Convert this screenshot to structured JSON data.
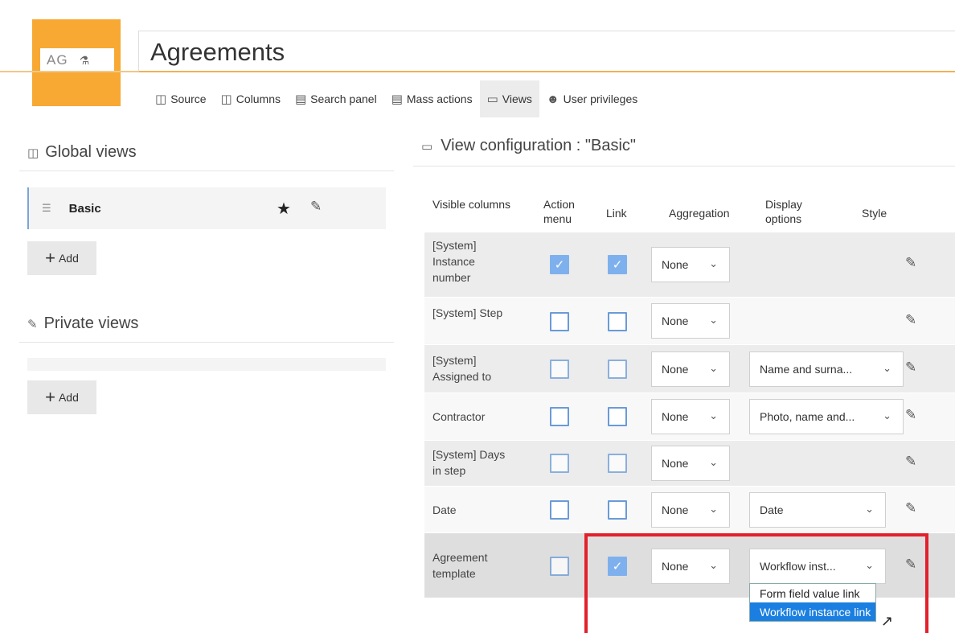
{
  "app": {
    "logo_text": "AG",
    "logo_icon": "user-tree-icon",
    "title": "Agreements"
  },
  "tabs": [
    {
      "label": "Source",
      "icon": "database-icon"
    },
    {
      "label": "Columns",
      "icon": "columns-icon"
    },
    {
      "label": "Search panel",
      "icon": "search-panel-icon"
    },
    {
      "label": "Mass actions",
      "icon": "mass-actions-icon"
    },
    {
      "label": "Views",
      "icon": "views-icon",
      "active": true
    },
    {
      "label": "User privileges",
      "icon": "user-icon"
    }
  ],
  "left": {
    "global_title": "Global views",
    "global_views": [
      {
        "name": "Basic",
        "favorite": true
      }
    ],
    "add_label": "Add",
    "private_title": "Private views",
    "private_add_label": "Add"
  },
  "config": {
    "title": "View configuration : \"Basic\"",
    "headers": {
      "visible_columns": "Visible columns",
      "action_menu": "Action menu",
      "link": "Link",
      "aggregation": "Aggregation",
      "display_options": "Display options",
      "style": "Style"
    },
    "rows": [
      {
        "label": "[System] Instance number",
        "action_menu": true,
        "link": true,
        "aggregation": "None",
        "display": ""
      },
      {
        "label": "[System] Step",
        "action_menu": false,
        "link": false,
        "aggregation": "None",
        "display": ""
      },
      {
        "label": "[System] Assigned to",
        "action_menu": false,
        "link": false,
        "aggregation": "None",
        "display": "Name and surna..."
      },
      {
        "label": "Contractor",
        "action_menu": false,
        "link": false,
        "aggregation": "None",
        "display": "Photo, name and..."
      },
      {
        "label": "[System] Days in step",
        "action_menu": false,
        "link": false,
        "aggregation": "None",
        "display": ""
      },
      {
        "label": "Date",
        "action_menu": false,
        "link": false,
        "aggregation": "None",
        "display": "Date"
      },
      {
        "label": "Agreement template",
        "action_menu": false,
        "link": true,
        "aggregation": "None",
        "display": "Workflow inst..."
      }
    ],
    "dropdown_options": [
      "Form field value link",
      "Workflow instance link"
    ],
    "dropdown_selected": "Workflow instance link"
  },
  "colors": {
    "accent": "#f7a934",
    "checkbox": "#6a9bd8",
    "highlight": "#e2202b",
    "selected_option": "#1a7fe0"
  }
}
